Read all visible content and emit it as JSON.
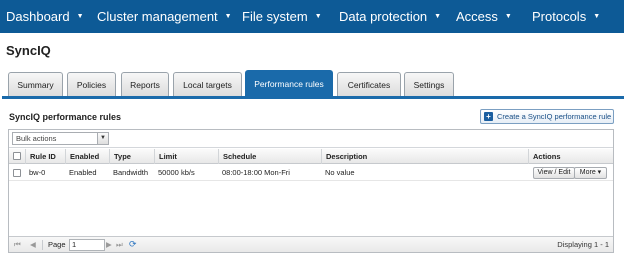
{
  "topnav": {
    "items": [
      {
        "label": "Dashboard"
      },
      {
        "label": "Cluster management"
      },
      {
        "label": "File system"
      },
      {
        "label": "Data protection"
      },
      {
        "label": "Access"
      },
      {
        "label": "Protocols"
      }
    ],
    "caret": "▼"
  },
  "page": {
    "title": "SyncIQ"
  },
  "tabs": [
    {
      "label": "Summary"
    },
    {
      "label": "Policies"
    },
    {
      "label": "Reports"
    },
    {
      "label": "Local targets"
    },
    {
      "label": "Performance rules",
      "active": true
    },
    {
      "label": "Certificates"
    },
    {
      "label": "Settings"
    }
  ],
  "section": {
    "title": "SyncIQ performance rules",
    "create_button": "Create a SyncIQ performance rule"
  },
  "grid": {
    "bulk_actions": {
      "selected": "Bulk actions"
    },
    "columns": [
      "Rule ID",
      "Enabled",
      "Type",
      "Limit",
      "Schedule",
      "Description",
      "Actions"
    ],
    "rows": [
      {
        "rule_id": "bw-0",
        "enabled": "Enabled",
        "type": "Bandwidth",
        "limit": "50000 kb/s",
        "schedule": "08:00-18:00 Mon-Fri",
        "description": "No value",
        "actions": {
          "view_edit": "View / Edit",
          "more": "More ▾"
        }
      }
    ],
    "pager": {
      "first": "⏮",
      "prev": "◀",
      "page_label": "Page",
      "page_value": "1",
      "next": "▶",
      "last": "⏭",
      "refresh": "⟳",
      "displaying": "Displaying 1 - 1"
    }
  },
  "colors": {
    "nav": "#0d5a96",
    "accent": "#1a6aaa"
  }
}
